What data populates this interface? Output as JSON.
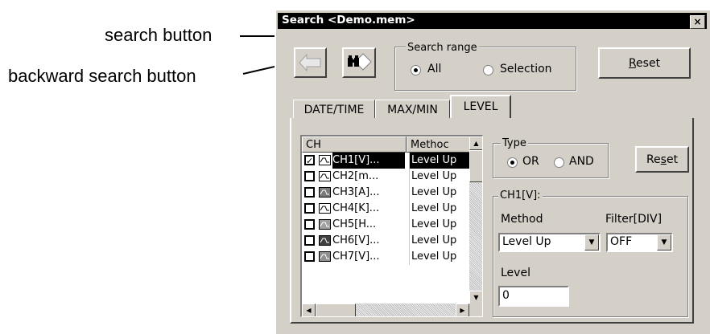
{
  "annotations": {
    "search_button": "search button",
    "backward_search_button": "backward search button"
  },
  "dialog": {
    "title": "Search <Demo.mem>",
    "close_glyph": "×"
  },
  "search_range": {
    "legend": "Search range",
    "options": [
      "All",
      "Selection"
    ],
    "selected": "All"
  },
  "reset_top": {
    "prefix": "",
    "key": "R",
    "rest": "eset"
  },
  "tabs": [
    "DATE/TIME",
    "MAX/MIN",
    "LEVEL"
  ],
  "active_tab": "LEVEL",
  "channel_list": {
    "columns": [
      "CH",
      "Methoc"
    ],
    "rows": [
      {
        "checked": true,
        "name": "CH1[V]...",
        "method": "Level Up",
        "icon_fill": "#ffffff"
      },
      {
        "checked": false,
        "name": "CH2[m...",
        "method": "Level Up",
        "icon_fill": "#ffffff"
      },
      {
        "checked": false,
        "name": "CH3[A]...",
        "method": "Level Up",
        "icon_fill": "#7a7a7a"
      },
      {
        "checked": false,
        "name": "CH4[K]...",
        "method": "Level Up",
        "icon_fill": "#ffffff"
      },
      {
        "checked": false,
        "name": "CH5[H...",
        "method": "Level Up",
        "icon_fill": "#a0a0a0"
      },
      {
        "checked": false,
        "name": "CH6[V]...",
        "method": "Level Up",
        "icon_fill": "#404040"
      },
      {
        "checked": false,
        "name": "CH7[V]...",
        "method": "Level Up",
        "icon_fill": "#909090"
      }
    ]
  },
  "type_group": {
    "legend": "Type",
    "options": [
      "OR",
      "AND"
    ],
    "selected": "OR"
  },
  "reset_type": {
    "prefix": "Re",
    "key": "s",
    "rest": "et"
  },
  "channel_group": {
    "legend": "CH1[V]:",
    "method_label": "Method",
    "method_value": "Level Up",
    "filter_label": "Filter[DIV]",
    "filter_value": "OFF",
    "level_label": "Level",
    "level_value": "0"
  }
}
